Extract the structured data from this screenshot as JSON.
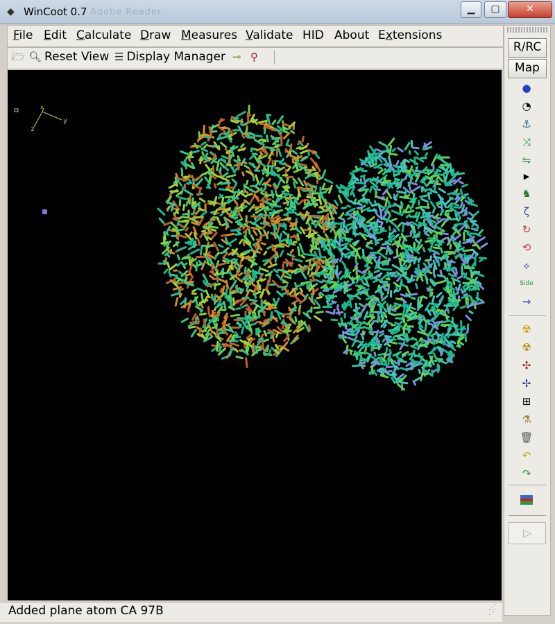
{
  "window": {
    "title": "WinCoot 0.7",
    "background_title_text": "Adobe Reader",
    "controls": {
      "minimize": "▁",
      "maximize": "▢",
      "close": "✕"
    }
  },
  "menubar": {
    "items": [
      {
        "label": "File",
        "mnemonic": "F",
        "rest": "ile"
      },
      {
        "label": "Edit",
        "mnemonic": "E",
        "rest": "dit"
      },
      {
        "label": "Calculate",
        "mnemonic": "C",
        "rest": "alculate"
      },
      {
        "label": "Draw",
        "mnemonic": "D",
        "rest": "raw"
      },
      {
        "label": "Measures",
        "mnemonic": "M",
        "rest": "easures"
      },
      {
        "label": "Validate",
        "mnemonic": "V",
        "rest": "alidate"
      },
      {
        "label": "HID",
        "mnemonic": "",
        "rest": "HID"
      },
      {
        "label": "About",
        "mnemonic": "",
        "rest": "About"
      },
      {
        "label": "Extensions",
        "mnemonic": "x",
        "pre": "E",
        "rest": "tensions"
      }
    ]
  },
  "toolbar": {
    "reset_view_label": "Reset View",
    "display_manager_label": "Display Manager"
  },
  "viewport": {
    "axes": {
      "x": "x",
      "y": "y",
      "z": "z"
    },
    "colors": [
      "#1ab890",
      "#2ec78f",
      "#6ad24a",
      "#7f8fe0",
      "#a8d030",
      "#c0602a",
      "#d48a2a",
      "#40c8c0"
    ]
  },
  "right_panel": {
    "rrc_label": "R/RC",
    "map_label": "Map",
    "tools": [
      "refine-sphere-icon",
      "regularize-zone-icon",
      "rigid-fit-icon",
      "rotamer-icon",
      "flip-peptide-icon",
      "arrow-right-icon",
      "side-chain-icon",
      "edit-chi-icon",
      "torsion-icon",
      "reverse-direction-icon",
      "backbone-icon",
      "side-180-icon",
      "ca-zone-icon",
      "add-atom-icon",
      "radioactive-icon",
      "add-terminal-icon",
      "delete-atom-icon",
      "place-atom-icon",
      "clear-pending-icon",
      "delete-icon",
      "undo-icon",
      "redo-icon",
      "flag-icon"
    ],
    "side_label": "Side",
    "play_label": "▷"
  },
  "status": {
    "message": "Added plane atom  CA  97B"
  }
}
